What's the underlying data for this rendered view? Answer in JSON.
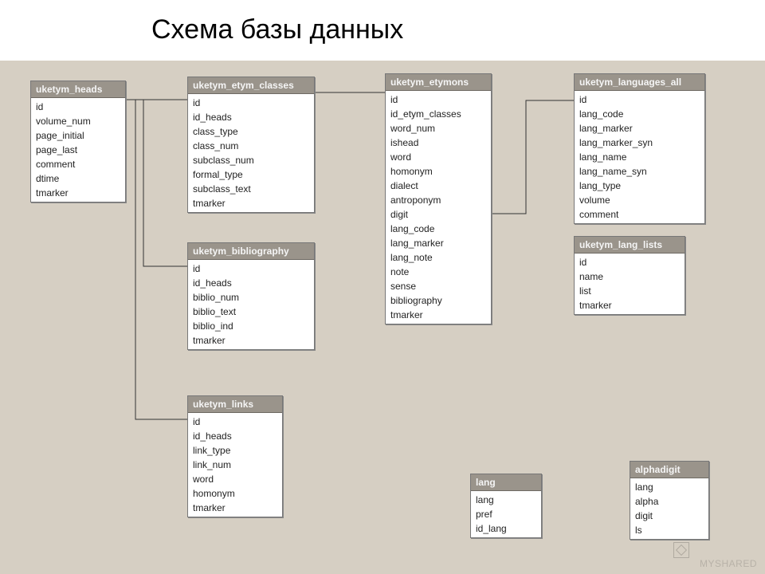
{
  "title": "Схема базы данных",
  "watermark": "MYSHARED",
  "tables": {
    "heads": {
      "name": "uketym_heads",
      "fields": [
        "id",
        "volume_num",
        "page_initial",
        "page_last",
        "comment",
        "dtime",
        "tmarker"
      ]
    },
    "etym_classes": {
      "name": "uketym_etym_classes",
      "fields": [
        "id",
        "id_heads",
        "class_type",
        "class_num",
        "subclass_num",
        "formal_type",
        "subclass_text",
        "tmarker"
      ]
    },
    "etymons": {
      "name": "uketym_etymons",
      "fields": [
        "id",
        "id_etym_classes",
        "word_num",
        "ishead",
        "word",
        "homonym",
        "dialect",
        "antroponym",
        "digit",
        "lang_code",
        "lang_marker",
        "lang_note",
        "note",
        "sense",
        "bibliography",
        "tmarker"
      ]
    },
    "languages_all": {
      "name": "uketym_languages_all",
      "fields": [
        "id",
        "lang_code",
        "lang_marker",
        "lang_marker_syn",
        "lang_name",
        "lang_name_syn",
        "lang_type",
        "volume",
        "comment"
      ]
    },
    "bibliography": {
      "name": "uketym_bibliography",
      "fields": [
        "id",
        "id_heads",
        "biblio_num",
        "biblio_text",
        "biblio_ind",
        "tmarker"
      ]
    },
    "lang_lists": {
      "name": "uketym_lang_lists",
      "fields": [
        "id",
        "name",
        "list",
        "tmarker"
      ]
    },
    "links": {
      "name": "uketym_links",
      "fields": [
        "id",
        "id_heads",
        "link_type",
        "link_num",
        "word",
        "homonym",
        "tmarker"
      ]
    },
    "lang": {
      "name": "lang",
      "fields": [
        "lang",
        "pref",
        "id_lang"
      ]
    },
    "alphadigit": {
      "name": "alphadigit",
      "fields": [
        "lang",
        "alpha",
        "digit",
        "ls"
      ]
    }
  },
  "connectors": [
    {
      "from": "heads",
      "to": "etym_classes"
    },
    {
      "from": "heads",
      "to": "bibliography"
    },
    {
      "from": "heads",
      "to": "links"
    },
    {
      "from": "etym_classes",
      "to": "etymons"
    },
    {
      "from": "etymons",
      "to": "languages_all"
    }
  ]
}
